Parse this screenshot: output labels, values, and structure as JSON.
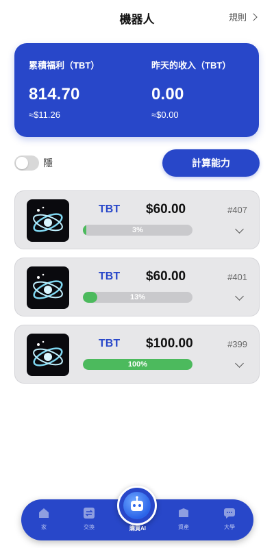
{
  "header": {
    "title": "機器人",
    "rules_label": "規則"
  },
  "summary": {
    "cumulative_label": "累積福利（TBT）",
    "cumulative_value": "814.70",
    "cumulative_usd": "≈$11.26",
    "yesterday_label": "昨天的收入（TBT）",
    "yesterday_value": "0.00",
    "yesterday_usd": "≈$0.00"
  },
  "controls": {
    "hide_label": "隱",
    "hide_on": false,
    "compute_label": "計算能力"
  },
  "robots": [
    {
      "token": "TBT",
      "price": "$60.00",
      "id": "#407",
      "progress": 0.03,
      "progress_label": "3%"
    },
    {
      "token": "TBT",
      "price": "$60.00",
      "id": "#401",
      "progress": 0.13,
      "progress_label": "13%"
    },
    {
      "token": "TBT",
      "price": "$100.00",
      "id": "#399",
      "progress": 1.0,
      "progress_label": "100%"
    }
  ],
  "nav": {
    "items": [
      {
        "label": "家",
        "icon": "home-icon"
      },
      {
        "label": "交換",
        "icon": "exchange-icon"
      },
      {
        "label": "購買AI",
        "icon": "robot-icon"
      },
      {
        "label": "資產",
        "icon": "wallet-icon"
      },
      {
        "label": "大學",
        "icon": "chat-icon"
      }
    ]
  },
  "colors": {
    "primary": "#2847c9",
    "progress": "#4cba5d",
    "card_bg": "#e7e7e9"
  }
}
